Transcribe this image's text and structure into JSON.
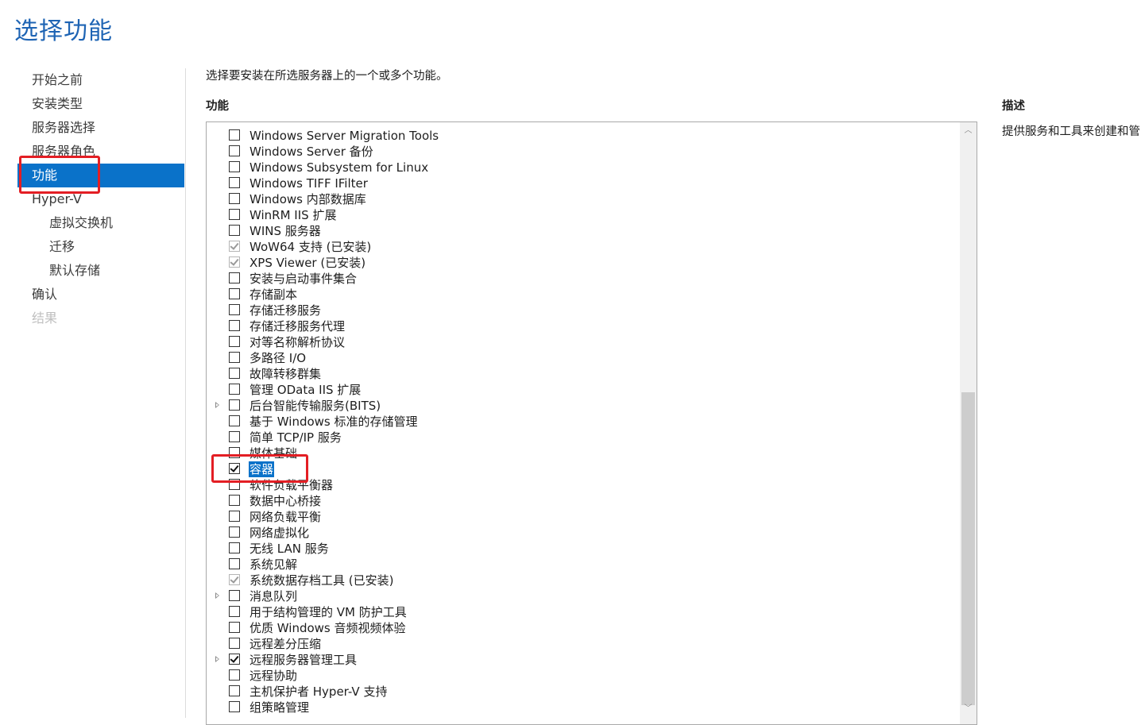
{
  "page": {
    "title": "选择功能",
    "intro": "选择要安装在所选服务器上的一个或多个功能。",
    "features_heading": "功能",
    "description_heading": "描述",
    "description_text": "提供服务和工具来创建和管"
  },
  "nav": [
    {
      "label": "开始之前",
      "state": "normal"
    },
    {
      "label": "安装类型",
      "state": "normal"
    },
    {
      "label": "服务器选择",
      "state": "normal"
    },
    {
      "label": "服务器角色",
      "state": "normal"
    },
    {
      "label": "功能",
      "state": "active"
    },
    {
      "label": "Hyper-V",
      "state": "normal"
    },
    {
      "label": "虚拟交换机",
      "state": "sub"
    },
    {
      "label": "迁移",
      "state": "sub"
    },
    {
      "label": "默认存储",
      "state": "sub"
    },
    {
      "label": "确认",
      "state": "normal"
    },
    {
      "label": "结果",
      "state": "disabled"
    }
  ],
  "features": [
    {
      "label": "Windows Server Migration Tools",
      "state": "unchecked",
      "expandable": false
    },
    {
      "label": "Windows Server 备份",
      "state": "unchecked",
      "expandable": false
    },
    {
      "label": "Windows Subsystem for Linux",
      "state": "unchecked",
      "expandable": false
    },
    {
      "label": "Windows TIFF IFilter",
      "state": "unchecked",
      "expandable": false
    },
    {
      "label": "Windows 内部数据库",
      "state": "unchecked",
      "expandable": false
    },
    {
      "label": "WinRM IIS 扩展",
      "state": "unchecked",
      "expandable": false
    },
    {
      "label": "WINS 服务器",
      "state": "unchecked",
      "expandable": false
    },
    {
      "label": "WoW64 支持 (已安装)",
      "state": "installed",
      "expandable": false
    },
    {
      "label": "XPS Viewer (已安装)",
      "state": "installed",
      "expandable": false
    },
    {
      "label": "安装与启动事件集合",
      "state": "unchecked",
      "expandable": false
    },
    {
      "label": "存储副本",
      "state": "unchecked",
      "expandable": false
    },
    {
      "label": "存储迁移服务",
      "state": "unchecked",
      "expandable": false
    },
    {
      "label": "存储迁移服务代理",
      "state": "unchecked",
      "expandable": false
    },
    {
      "label": "对等名称解析协议",
      "state": "unchecked",
      "expandable": false
    },
    {
      "label": "多路径 I/O",
      "state": "unchecked",
      "expandable": false
    },
    {
      "label": "故障转移群集",
      "state": "unchecked",
      "expandable": false
    },
    {
      "label": "管理 OData IIS 扩展",
      "state": "unchecked",
      "expandable": false
    },
    {
      "label": "后台智能传输服务(BITS)",
      "state": "unchecked",
      "expandable": true
    },
    {
      "label": "基于 Windows 标准的存储管理",
      "state": "unchecked",
      "expandable": false
    },
    {
      "label": "简单 TCP/IP 服务",
      "state": "unchecked",
      "expandable": false
    },
    {
      "label": "媒体基础",
      "state": "unchecked",
      "expandable": false
    },
    {
      "label": "容器",
      "state": "checked",
      "expandable": false,
      "selected": true
    },
    {
      "label": "软件负载平衡器",
      "state": "unchecked",
      "expandable": false
    },
    {
      "label": "数据中心桥接",
      "state": "unchecked",
      "expandable": false
    },
    {
      "label": "网络负载平衡",
      "state": "unchecked",
      "expandable": false
    },
    {
      "label": "网络虚拟化",
      "state": "unchecked",
      "expandable": false
    },
    {
      "label": "无线 LAN 服务",
      "state": "unchecked",
      "expandable": false
    },
    {
      "label": "系统见解",
      "state": "unchecked",
      "expandable": false
    },
    {
      "label": "系统数据存档工具 (已安装)",
      "state": "installed",
      "expandable": false
    },
    {
      "label": "消息队列",
      "state": "unchecked",
      "expandable": true
    },
    {
      "label": "用于结构管理的 VM 防护工具",
      "state": "unchecked",
      "expandable": false
    },
    {
      "label": "优质 Windows 音频视频体验",
      "state": "unchecked",
      "expandable": false
    },
    {
      "label": "远程差分压缩",
      "state": "unchecked",
      "expandable": false
    },
    {
      "label": "远程服务器管理工具",
      "state": "checked",
      "expandable": true
    },
    {
      "label": "远程协助",
      "state": "unchecked",
      "expandable": false
    },
    {
      "label": "主机保护者 Hyper-V 支持",
      "state": "unchecked",
      "expandable": false
    },
    {
      "label": "组策略管理",
      "state": "unchecked",
      "expandable": false
    }
  ],
  "annotations": {
    "color": "#e31e24"
  }
}
